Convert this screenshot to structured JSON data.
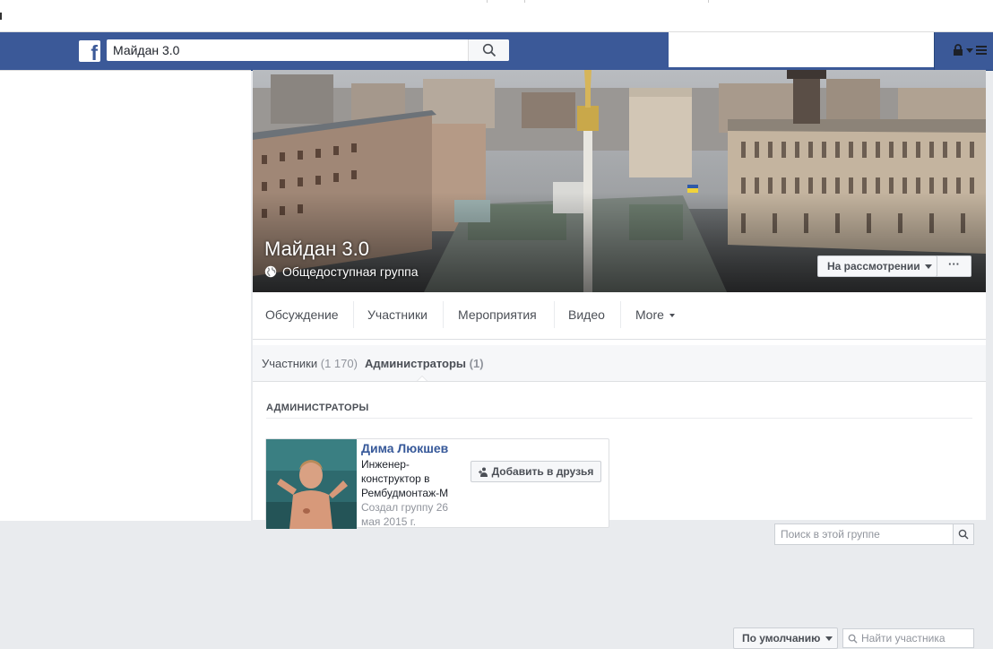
{
  "header": {
    "logo": "f",
    "search_value": "Майдан 3.0",
    "icons": [
      "facebook-icon",
      "search-icon",
      "lock-icon",
      "chevron-down-icon"
    ]
  },
  "group": {
    "title": "Майдан 3.0",
    "privacy": "Общедоступная группа",
    "review_button": "На рассмотрении",
    "more_button": "···"
  },
  "tabs": [
    {
      "label": "Обсуждение"
    },
    {
      "label": "Участники"
    },
    {
      "label": "Мероприятия"
    },
    {
      "label": "Видео"
    },
    {
      "label": "More"
    }
  ],
  "group_search": {
    "placeholder": "Поиск в этой группе"
  },
  "members_bar": {
    "members_label": "Участники",
    "members_count": "(1 170)",
    "admins_label": "Администраторы",
    "admins_count": "(1)",
    "sort_label": "По умолчанию",
    "member_search_placeholder": "Найти участника"
  },
  "admins_section": {
    "title": "АДМИНИСТРАТОРЫ",
    "admins": [
      {
        "name": "Дима Люкшев",
        "description": "Инженер-конструктор в Рембудмонтаж-М",
        "created": "Создал группу 26 мая 2015 г.",
        "add_friend": "Добавить в друзья"
      }
    ]
  },
  "colors": {
    "brand_blue": "#3b5998",
    "link_blue": "#365899",
    "background": "#e9ebee"
  }
}
